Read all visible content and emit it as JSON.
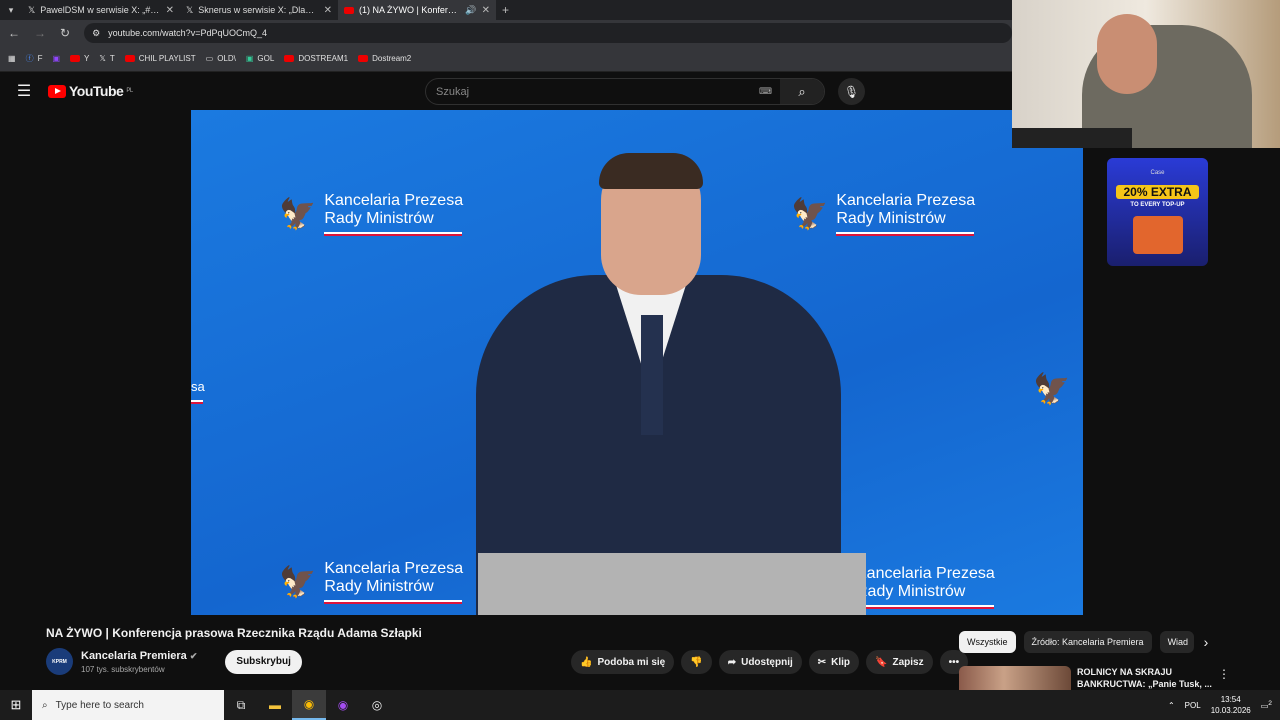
{
  "tabs": [
    {
      "title": "PawelDSM w serwisie X: „#brut",
      "icon": "x-icon",
      "active": false
    },
    {
      "title": "Sknerus w serwisie X: „Dlacze",
      "icon": "x-icon",
      "active": false
    },
    {
      "title": "(1) NA ŻYWO | Konferencja",
      "icon": "youtube-icon",
      "active": true
    }
  ],
  "address": {
    "url": "youtube.com/watch?v=PdPqUOCmQ_4"
  },
  "bookmarks": [
    "F",
    "",
    "Y",
    "T",
    "CHIL PLAYLIST",
    "OLD\\",
    "GOL",
    "DOSTREAM1",
    "Dostream2"
  ],
  "youtube": {
    "logo_text": "YouTube",
    "region": "PL",
    "search_placeholder": "Szukaj"
  },
  "video": {
    "watermark_line1": "Kancelaria Prezesa",
    "watermark_line2": "Rady Ministrów",
    "partial_text": "sa"
  },
  "info": {
    "title": "NA ŻYWO | Konferencja prasowa Rzecznika Rządu Adama Szłapki",
    "channel": "Kancelaria Premiera",
    "channel_avatar_text": "KPRM",
    "subscribers": "107 tys. subskrybentów",
    "subscribe": "Subskrybuj",
    "like": "Podoba mi się",
    "share": "Udostępnij",
    "clip": "Klip",
    "save": "Zapisz"
  },
  "chips": [
    "Wszystkie",
    "Źródło: Kancelaria Premiera",
    "Wiad"
  ],
  "related": {
    "title": "ROLNICY NA SKRAJU BANKRUCTWA: „Panie Tusk, ..."
  },
  "ad": {
    "brand": "Case",
    "headline": "20% EXTRA",
    "sub": "TO EVERY TOP-UP"
  },
  "taskbar": {
    "search": "Type here to search",
    "lang": "POL",
    "time": "13:54",
    "date": "10.03.2026",
    "notif": "2"
  }
}
